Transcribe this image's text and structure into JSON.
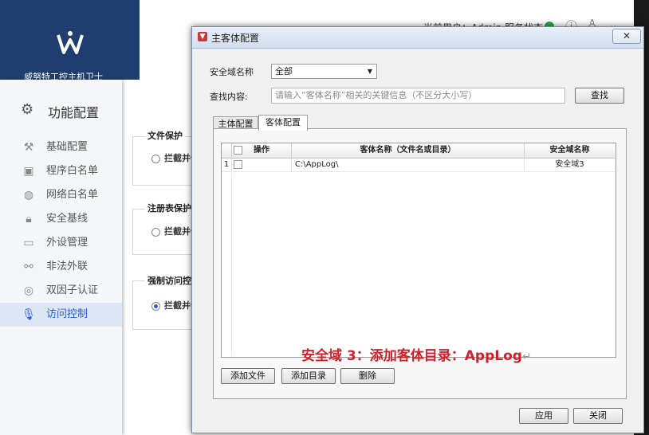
{
  "app": {
    "header": {
      "current_user_text": "当前用户：Admin 服务状态",
      "status_color": "#2fa84f"
    },
    "logo_text": "威努特工控主机卫士",
    "sidebar": {
      "title": "功能配置",
      "items": [
        {
          "label": "基础配置",
          "icon": "wrench-icon",
          "glyph": "⚒"
        },
        {
          "label": "程序白名单",
          "icon": "program-icon",
          "glyph": "▣"
        },
        {
          "label": "网络白名单",
          "icon": "globe-icon",
          "glyph": "◍"
        },
        {
          "label": "安全基线",
          "icon": "lock-icon",
          "glyph": "🔒︎"
        },
        {
          "label": "外设管理",
          "icon": "monitor-icon",
          "glyph": "▭"
        },
        {
          "label": "非法外联",
          "icon": "link-off-icon",
          "glyph": "⚯"
        },
        {
          "label": "双因子认证",
          "icon": "two-factor-icon",
          "glyph": "◎"
        },
        {
          "label": "访问控制",
          "icon": "microphone-icon",
          "glyph": "🎙︎"
        }
      ]
    },
    "groups": [
      {
        "title": "文件保护",
        "option": "拦截并告警"
      },
      {
        "title": "注册表保护",
        "option": "拦截并告警"
      },
      {
        "title": "强制访问控制",
        "option": "拦截并告警"
      }
    ]
  },
  "dialog": {
    "title": "主客体配置",
    "close_label": "✕",
    "domain_label": "安全域名称",
    "domain_value": "全部",
    "search_label": "查找内容:",
    "search_placeholder": "请输入“客体名称”相关的关键信息（不区分大小写）",
    "search_button": "查找",
    "tabs": [
      "主体配置",
      "客体配置"
    ],
    "active_tab": 1,
    "table": {
      "columns": [
        "操作",
        "客体名称（文件名或目录）",
        "安全域名称"
      ],
      "rows": [
        {
          "index": "1",
          "name": "C:\\AppLog\\",
          "domain": "安全域3"
        }
      ]
    },
    "add_file_button": "添加文件",
    "add_dir_button": "添加目录",
    "delete_button": "删除",
    "apply_button": "应用",
    "close_button": "关闭"
  },
  "annotation": {
    "text": "安全域 3：添加客体目录：AppLog",
    "return_mark": "↵",
    "color": "#d0202a"
  }
}
